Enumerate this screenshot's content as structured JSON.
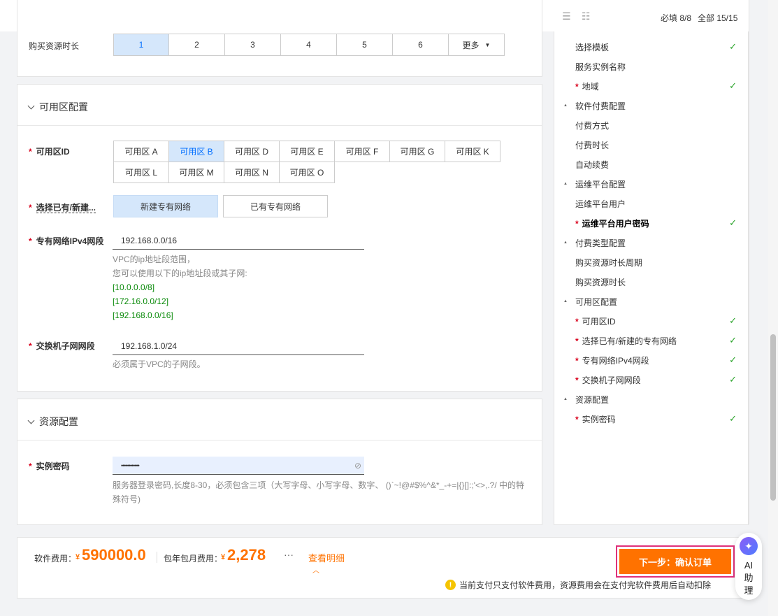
{
  "toolbar": {
    "required_text": "必填 8/8",
    "all_text": "全部 15/15"
  },
  "duration": {
    "label": "购买资源时长",
    "options": [
      "1",
      "2",
      "3",
      "4",
      "5",
      "6"
    ],
    "more": "更多"
  },
  "az_section": {
    "title": "可用区配置",
    "az_label": "可用区ID",
    "zones": [
      "可用区 A",
      "可用区 B",
      "可用区 D",
      "可用区 E",
      "可用区 F",
      "可用区 G",
      "可用区 K",
      "可用区 L",
      "可用区 M",
      "可用区 N",
      "可用区 O"
    ],
    "vpc_choice_label": "选择已有/新建...",
    "vpc_new": "新建专有网络",
    "vpc_existing": "已有专有网络",
    "ipv4_label": "专有网络IPv4网段",
    "ipv4_value": "192.168.0.0/16",
    "ipv4_help_1": "VPC的ip地址段范围，",
    "ipv4_help_2": "您可以使用以下的ip地址段或其子网:",
    "ipv4_opt_1": "[10.0.0.0/8]",
    "ipv4_opt_2": "[172.16.0.0/12]",
    "ipv4_opt_3": "[192.168.0.0/16]",
    "vswitch_label": "交换机子网网段",
    "vswitch_value": "192.168.1.0/24",
    "vswitch_help": "必须属于VPC的子网段。"
  },
  "res_section": {
    "title": "资源配置",
    "password_label": "实例密码",
    "password_value": "••••••••••••",
    "password_help": "服务器登录密码,长度8-30，必须包含三项（大写字母、小写字母、数字、 ()`~!@#$%^&*_-+=|{}[]:;'<>,.?/ 中的特殊符号)"
  },
  "nav": [
    {
      "label": "选择模板",
      "req": false,
      "check": true,
      "group": false
    },
    {
      "label": "服务实例名称",
      "req": false,
      "check": false,
      "group": false
    },
    {
      "label": "地域",
      "req": true,
      "check": true,
      "group": false
    },
    {
      "label": "软件付费配置",
      "req": false,
      "check": false,
      "group": true
    },
    {
      "label": "付费方式",
      "req": false,
      "check": false,
      "group": false
    },
    {
      "label": "付费时长",
      "req": false,
      "check": false,
      "group": false
    },
    {
      "label": "自动续费",
      "req": false,
      "check": false,
      "group": false
    },
    {
      "label": "运维平台配置",
      "req": false,
      "check": false,
      "group": true
    },
    {
      "label": "运维平台用户",
      "req": false,
      "check": false,
      "group": false
    },
    {
      "label": "运维平台用户密码",
      "req": true,
      "check": true,
      "group": false,
      "bold": true
    },
    {
      "label": "付费类型配置",
      "req": false,
      "check": false,
      "group": true
    },
    {
      "label": "购买资源时长周期",
      "req": false,
      "check": false,
      "group": false
    },
    {
      "label": "购买资源时长",
      "req": false,
      "check": false,
      "group": false
    },
    {
      "label": "可用区配置",
      "req": false,
      "check": false,
      "group": true
    },
    {
      "label": "可用区ID",
      "req": true,
      "check": true,
      "group": false
    },
    {
      "label": "选择已有/新建的专有网络",
      "req": true,
      "check": true,
      "group": false
    },
    {
      "label": "专有网络IPv4网段",
      "req": true,
      "check": true,
      "group": false
    },
    {
      "label": "交换机子网网段",
      "req": true,
      "check": true,
      "group": false
    },
    {
      "label": "资源配置",
      "req": false,
      "check": false,
      "group": true
    },
    {
      "label": "实例密码",
      "req": true,
      "check": true,
      "group": false
    }
  ],
  "footer": {
    "software_fee_label": "软件费用：",
    "currency": "¥",
    "software_fee": "590000.0",
    "subscription_label": "包年包月费用：",
    "subscription_fee": "2,278",
    "more": "···",
    "details_link": "查看明细",
    "next_button": "下一步：确认订单",
    "notice": "当前支付只支付软件费用，资源费用会在支付完软件费用后自动扣除"
  },
  "ai_assistant": {
    "line1": "AI",
    "line2": "助",
    "line3": "理"
  },
  "colors": {
    "accent": "#ff7200",
    "selected_bg": "#d5e7fb",
    "required": "#d9001b",
    "check": "#29a329"
  }
}
